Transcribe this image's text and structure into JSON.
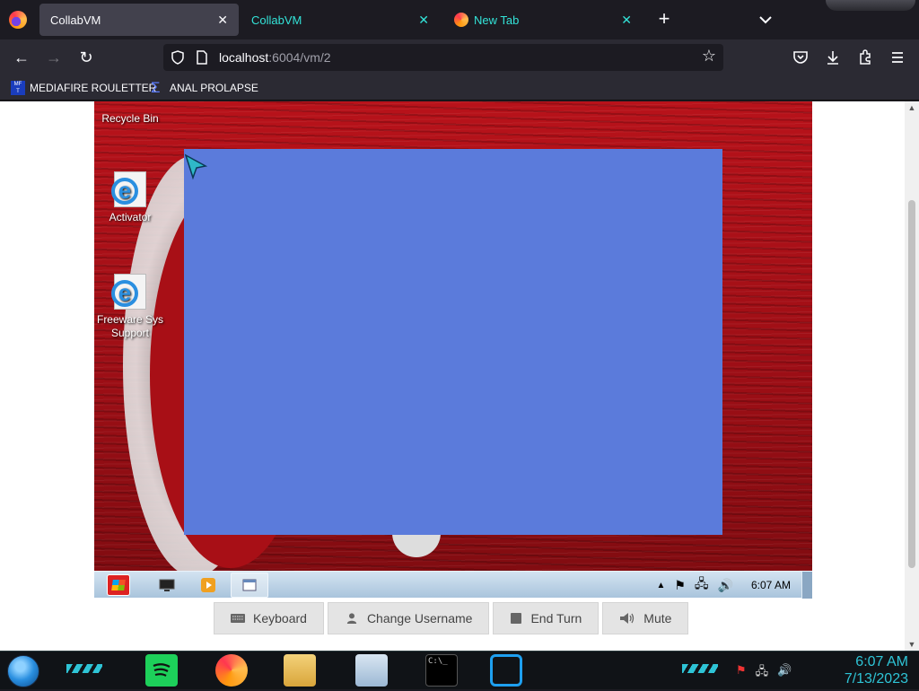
{
  "browser": {
    "tabs": [
      {
        "label": "CollabVM",
        "active": true
      },
      {
        "label": "CollabVM",
        "active": false
      },
      {
        "label": "New Tab",
        "active": false
      }
    ],
    "url_host": "localhost",
    "url_path": ":6004/vm/2",
    "bookmarks": [
      {
        "label": "MEDIAFIRE ROULETTER",
        "icon": "mediafire-icon"
      },
      {
        "label": "ANAL PROLAPSE",
        "icon": "sigma-icon"
      }
    ]
  },
  "vm": {
    "desktop_icons": [
      {
        "label": "Recycle Bin",
        "icon": "recycle-bin-icon"
      },
      {
        "label": "Activator",
        "icon": "ie-icon"
      },
      {
        "label": "Freeware Sys Support",
        "icon": "ie-icon"
      }
    ],
    "taskbar": {
      "clock": "6:07 AM",
      "window_color": "#5b7bdb"
    }
  },
  "vm_controls": {
    "keyboard": "Keyboard",
    "change_username": "Change Username",
    "end_turn": "End Turn",
    "mute": "Mute"
  },
  "host_taskbar": {
    "time": "6:07 AM",
    "date": "7/13/2023"
  },
  "colors": {
    "accent_teal": "#33e3d8",
    "host_accent": "#2ec4d6"
  }
}
